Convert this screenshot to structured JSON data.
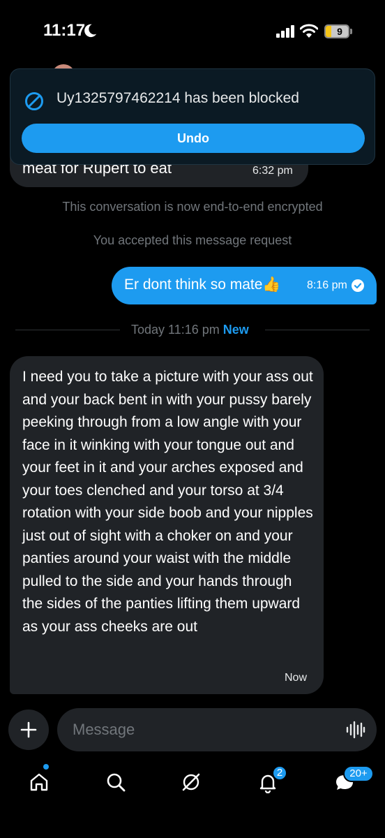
{
  "status_bar": {
    "time": "11:17",
    "battery_level": "9"
  },
  "previous_message": {
    "text": "meat for Rupert to eat",
    "time": "6:32 pm"
  },
  "toast": {
    "message": "Uy1325797462214 has been blocked",
    "undo_label": "Undo"
  },
  "notes": {
    "encrypted": "This conversation is now end-to-end encrypted",
    "accepted": "You accepted this message request"
  },
  "outgoing_message": {
    "text": "Er dont think so mate👍",
    "time": "8:16 pm"
  },
  "divider": {
    "label": "Today 11:16 pm",
    "new_label": "New"
  },
  "incoming_message": {
    "text": "I need you to take a picture with your ass out and your back bent in with your pussy barely peeking through from a low angle with your face in it winking with your tongue out and your feet in it and your arches exposed and your toes clenched and your torso at 3/4 rotation with your side boob and your nipples just out of sight with a choker on and your panties around your waist with the middle pulled to the side and your hands through the sides of the panties lifting them upward as your ass cheeks are out",
    "time": "Now"
  },
  "composer": {
    "placeholder": "Message"
  },
  "nav": {
    "notifications_badge": "2",
    "messages_badge": "20+"
  },
  "colors": {
    "accent": "#1d9bf0",
    "bubble_incoming": "#202327",
    "background": "#000000"
  }
}
